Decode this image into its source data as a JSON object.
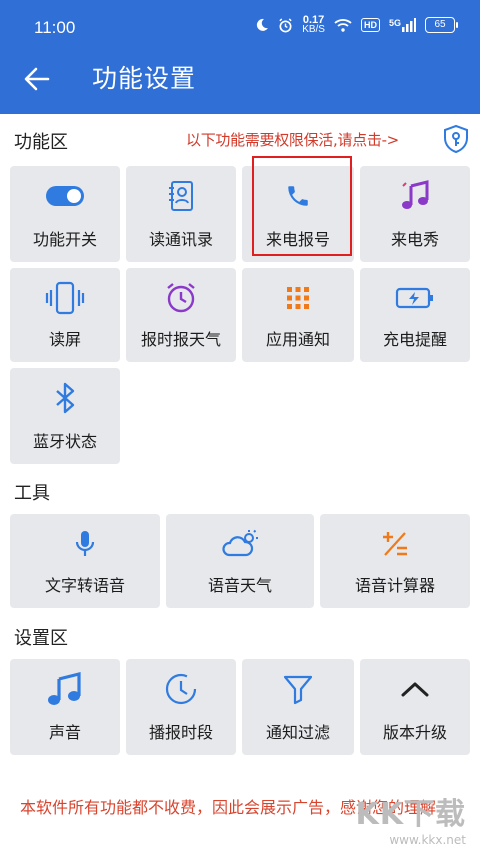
{
  "status_bar": {
    "time": "11:00",
    "net_speed_value": "0.17",
    "net_speed_unit": "KB/S",
    "hd_badge": "HD",
    "signal_label": "5G",
    "battery": "65"
  },
  "header": {
    "title": "功能设置"
  },
  "sections": {
    "features": {
      "label": "功能区",
      "hint": "以下功能需要权限保活,请点击->",
      "tiles": [
        {
          "label": "功能开关",
          "icon": "toggle-icon"
        },
        {
          "label": "读通讯录",
          "icon": "contacts-book-icon"
        },
        {
          "label": "来电报号",
          "icon": "phone-icon"
        },
        {
          "label": "来电秀",
          "icon": "music-note-icon"
        },
        {
          "label": "读屏",
          "icon": "phone-vibrate-icon"
        },
        {
          "label": "报时报天气",
          "icon": "alarm-clock-icon"
        },
        {
          "label": "应用通知",
          "icon": "app-grid-icon"
        },
        {
          "label": "充电提醒",
          "icon": "battery-charging-icon"
        },
        {
          "label": "蓝牙状态",
          "icon": "bluetooth-icon"
        }
      ]
    },
    "tools": {
      "label": "工具",
      "tiles": [
        {
          "label": "文字转语音",
          "icon": "microphone-icon"
        },
        {
          "label": "语音天气",
          "icon": "weather-icon"
        },
        {
          "label": "语音计算器",
          "icon": "calculator-icon"
        }
      ]
    },
    "settings": {
      "label": "设置区",
      "tiles": [
        {
          "label": "声音",
          "icon": "music-note-icon"
        },
        {
          "label": "播报时段",
          "icon": "clock-icon"
        },
        {
          "label": "通知过滤",
          "icon": "filter-icon"
        },
        {
          "label": "版本升级",
          "icon": "chevron-up-icon"
        }
      ]
    }
  },
  "footer_note": "本软件所有功能都不收费，因此会展示广告，感谢您的理解",
  "watermark": {
    "logo": "KK下载",
    "url": "www.kkx.net"
  },
  "colors": {
    "header_bg": "#2f6fd6",
    "tile_bg": "#e6e8eb",
    "icon_blue": "#2f7be0",
    "icon_purple": "#8a39c9",
    "icon_orange": "#f07a1a",
    "hint_red": "#d23a2a",
    "highlight_red": "#e02020"
  }
}
